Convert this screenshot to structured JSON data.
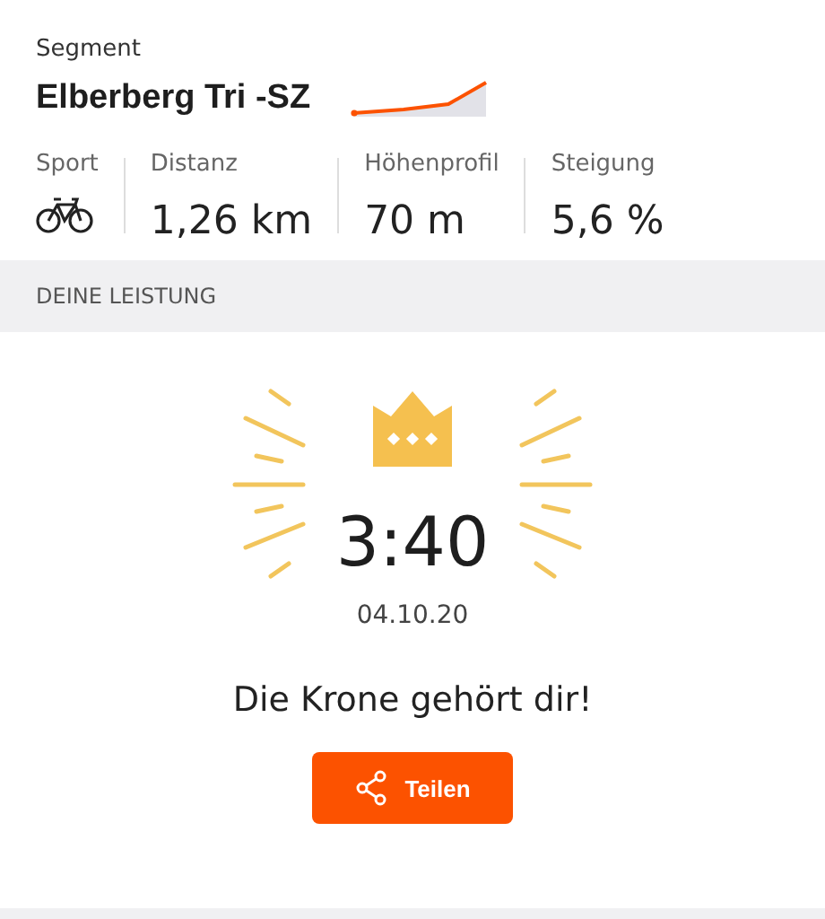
{
  "segment": {
    "caption": "Segment",
    "title": "Elberberg Tri -SZ"
  },
  "stats": [
    {
      "label": "Sport",
      "kind": "icon"
    },
    {
      "label": "Distanz",
      "kind": "text",
      "value": "1,26 km"
    },
    {
      "label": "Höhenprofil",
      "kind": "text",
      "value": "70 m"
    },
    {
      "label": "Steigung",
      "kind": "text",
      "value": "5,6 %"
    }
  ],
  "section": {
    "heading": "DEINE LEISTUNG"
  },
  "result": {
    "time": "3:40",
    "date": "04.10.20",
    "message": "Die Krone gehört dir!"
  },
  "buttons": [
    {
      "label": "Teilen",
      "kind": "share"
    }
  ]
}
